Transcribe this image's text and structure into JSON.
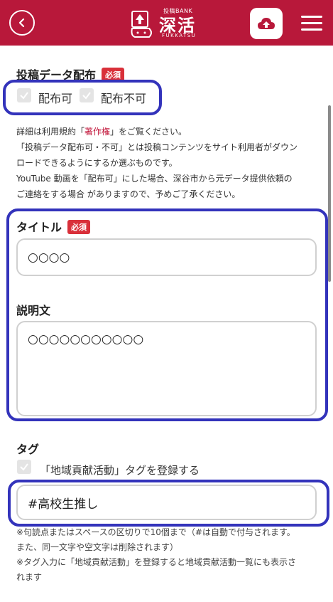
{
  "header": {
    "logo_small": "投稿BANK",
    "logo_main": "深活",
    "logo_sub": "FUKKATSU",
    "back_icon": "chevron-left-icon",
    "upload_icon": "cloud-upload-icon",
    "menu_icon": "hamburger-menu-icon",
    "brand_color": "#b8183a"
  },
  "distribution": {
    "label": "投稿データ配布",
    "required": "必須",
    "option_allow": "配布可",
    "option_deny": "配布不可",
    "desc_line1_pre": "詳細は利用規約「",
    "desc_link": "著作権",
    "desc_line1_post": "」をご覧ください。",
    "desc_line2": "「投稿データ配布可・不可」とは投稿コンテンツをサイト利用者がダウン",
    "desc_line3": "ロードできるようにするか選ぶものです。",
    "desc_line4": "YouTube 動画を「配布可」にした場合、深谷市から元データ提供依頼の",
    "desc_line5": "ご連絡をする場合 がありますので、予めご了承ください。"
  },
  "title_field": {
    "label": "タイトル",
    "required": "必須",
    "value": "○○○○"
  },
  "description_field": {
    "label": "説明文",
    "value": "○○○○○○○○○○○"
  },
  "tags": {
    "label": "タグ",
    "checkbox_label": "「地域貢献活動」タグを登録する",
    "value": "#高校生推し",
    "note1": "※句読点またはスペースの区切りで10個まで（#は自動で付与されます。",
    "note2": "また、同一文字や空文字は削除されます）",
    "note3": "※タグ入力に「地域貢献活動」を登録すると地域貢献活動一覧にも表示さ",
    "note4": "れます"
  },
  "colors": {
    "required_badge": "#d9303a",
    "highlight": "#3333bb",
    "link": "#c2183c"
  }
}
